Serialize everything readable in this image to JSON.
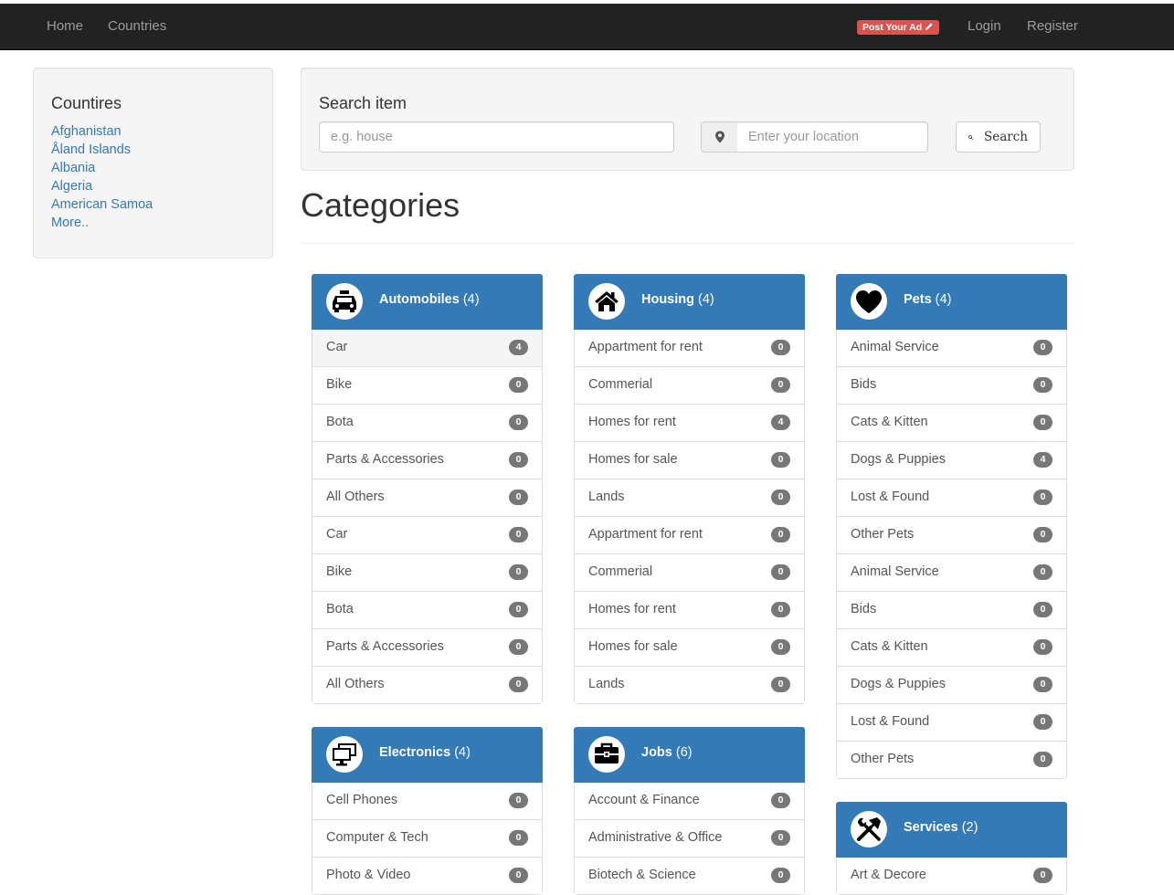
{
  "nav": {
    "home": "Home",
    "countries": "Countries",
    "post_ad": "Post Your Ad",
    "login": "Login",
    "register": "Register"
  },
  "sidebar": {
    "title": "Countires",
    "items": [
      "Afghanistan",
      "Åland Islands",
      "Albania",
      "Algeria",
      "American Samoa",
      "More.."
    ]
  },
  "search": {
    "title": "Search item",
    "item_placeholder": "e.g. house",
    "location_placeholder": "Enter your location",
    "button_label": "Search"
  },
  "page_title": "Categories",
  "categories": [
    {
      "name": "Automobiles",
      "count": "(4)",
      "icon": "car-icon",
      "items": [
        {
          "name": "Car",
          "count": "4",
          "active": true
        },
        {
          "name": "Bike",
          "count": "0"
        },
        {
          "name": "Bota",
          "count": "0"
        },
        {
          "name": "Parts & Accessories",
          "count": "0"
        },
        {
          "name": "All Others",
          "count": "0"
        },
        {
          "name": "Car",
          "count": "0"
        },
        {
          "name": "Bike",
          "count": "0"
        },
        {
          "name": "Bota",
          "count": "0"
        },
        {
          "name": "Parts & Accessories",
          "count": "0"
        },
        {
          "name": "All Others",
          "count": "0"
        }
      ]
    },
    {
      "name": "Housing",
      "count": "(4)",
      "icon": "house-icon",
      "items": [
        {
          "name": "Appartment for rent",
          "count": "0"
        },
        {
          "name": "Commerial",
          "count": "0"
        },
        {
          "name": "Homes for rent",
          "count": "4"
        },
        {
          "name": "Homes for sale",
          "count": "0"
        },
        {
          "name": "Lands",
          "count": "0"
        },
        {
          "name": "Appartment for rent",
          "count": "0"
        },
        {
          "name": "Commerial",
          "count": "0"
        },
        {
          "name": "Homes for rent",
          "count": "0"
        },
        {
          "name": "Homes for sale",
          "count": "0"
        },
        {
          "name": "Lands",
          "count": "0"
        }
      ]
    },
    {
      "name": "Pets",
      "count": "(4)",
      "icon": "heart-icon",
      "items": [
        {
          "name": "Animal Service",
          "count": "0"
        },
        {
          "name": "Bids",
          "count": "0"
        },
        {
          "name": "Cats & Kitten",
          "count": "0"
        },
        {
          "name": "Dogs & Puppies",
          "count": "4"
        },
        {
          "name": "Lost & Found",
          "count": "0"
        },
        {
          "name": "Other Pets",
          "count": "0"
        },
        {
          "name": "Animal Service",
          "count": "0"
        },
        {
          "name": "Bids",
          "count": "0"
        },
        {
          "name": "Cats & Kitten",
          "count": "0"
        },
        {
          "name": "Dogs & Puppies",
          "count": "0"
        },
        {
          "name": "Lost & Found",
          "count": "0"
        },
        {
          "name": "Other Pets",
          "count": "0"
        }
      ]
    },
    {
      "name": "Electronics",
      "count": "(4)",
      "icon": "desktop-icon",
      "items": [
        {
          "name": "Cell Phones",
          "count": "0"
        },
        {
          "name": "Computer & Tech",
          "count": "0"
        },
        {
          "name": "Photo & Video",
          "count": "0"
        }
      ]
    },
    {
      "name": "Jobs",
      "count": "(6)",
      "icon": "briefcase-icon",
      "items": [
        {
          "name": "Account & Finance",
          "count": "0"
        },
        {
          "name": "Administrative & Office",
          "count": "0"
        },
        {
          "name": "Biotech & Science",
          "count": "0"
        }
      ]
    },
    {
      "name": "Services",
      "count": "(2)",
      "icon": "tools-icon",
      "items": [
        {
          "name": "Art & Decore",
          "count": "0"
        }
      ]
    }
  ],
  "colors": {
    "navbar": "#222222",
    "primary": "#337ab7",
    "danger": "#d9534f",
    "badge": "#777777",
    "link": "#337ab7"
  }
}
